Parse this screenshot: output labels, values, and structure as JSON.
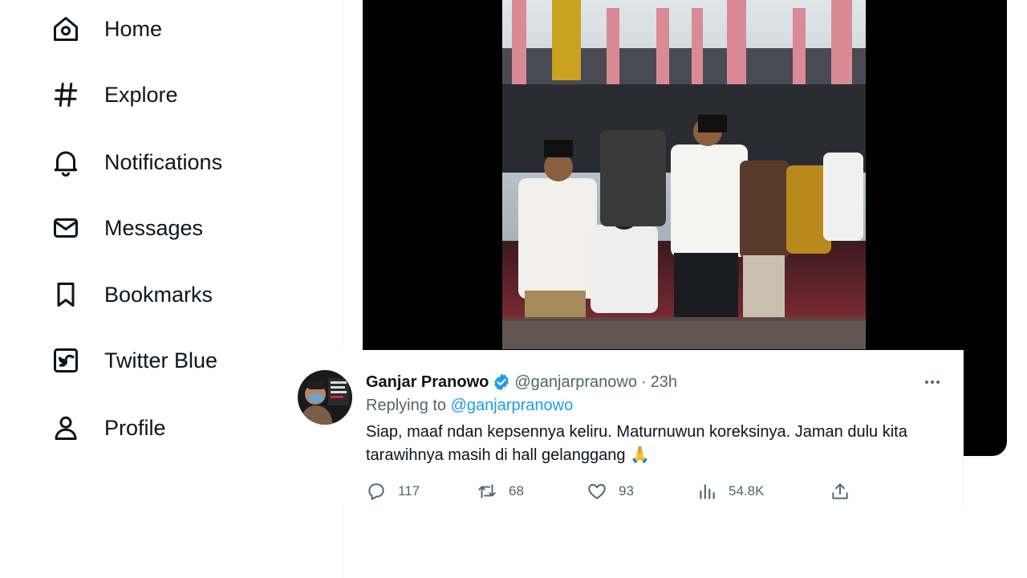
{
  "sidebar": {
    "items": [
      {
        "label": "Home",
        "icon": "home-icon"
      },
      {
        "label": "Explore",
        "icon": "hashtag-icon"
      },
      {
        "label": "Notifications",
        "icon": "bell-icon"
      },
      {
        "label": "Messages",
        "icon": "envelope-icon"
      },
      {
        "label": "Bookmarks",
        "icon": "bookmark-icon"
      },
      {
        "label": "Twitter Blue",
        "icon": "twitter-blue-icon"
      },
      {
        "label": "Profile",
        "icon": "person-icon"
      }
    ]
  },
  "reply": {
    "author_name": "Ganjar Pranowo",
    "handle": "@ganjarpranowo",
    "separator": "·",
    "time": "23h",
    "replying_prefix": "Replying to",
    "replying_handle": "@ganjarpranowo",
    "text": "Siap, maaf ndan kepsennya keliru. Maturnuwun koreksinya. Jaman dulu kita tarawihnya masih di hall gelanggang 🙏",
    "actions": {
      "replies": "117",
      "retweets": "68",
      "likes": "93",
      "views": "54.8K"
    }
  },
  "colors": {
    "accent": "#1d9bf0",
    "text_primary": "#0f1419",
    "text_secondary": "#536471",
    "media_background": "#000000"
  }
}
